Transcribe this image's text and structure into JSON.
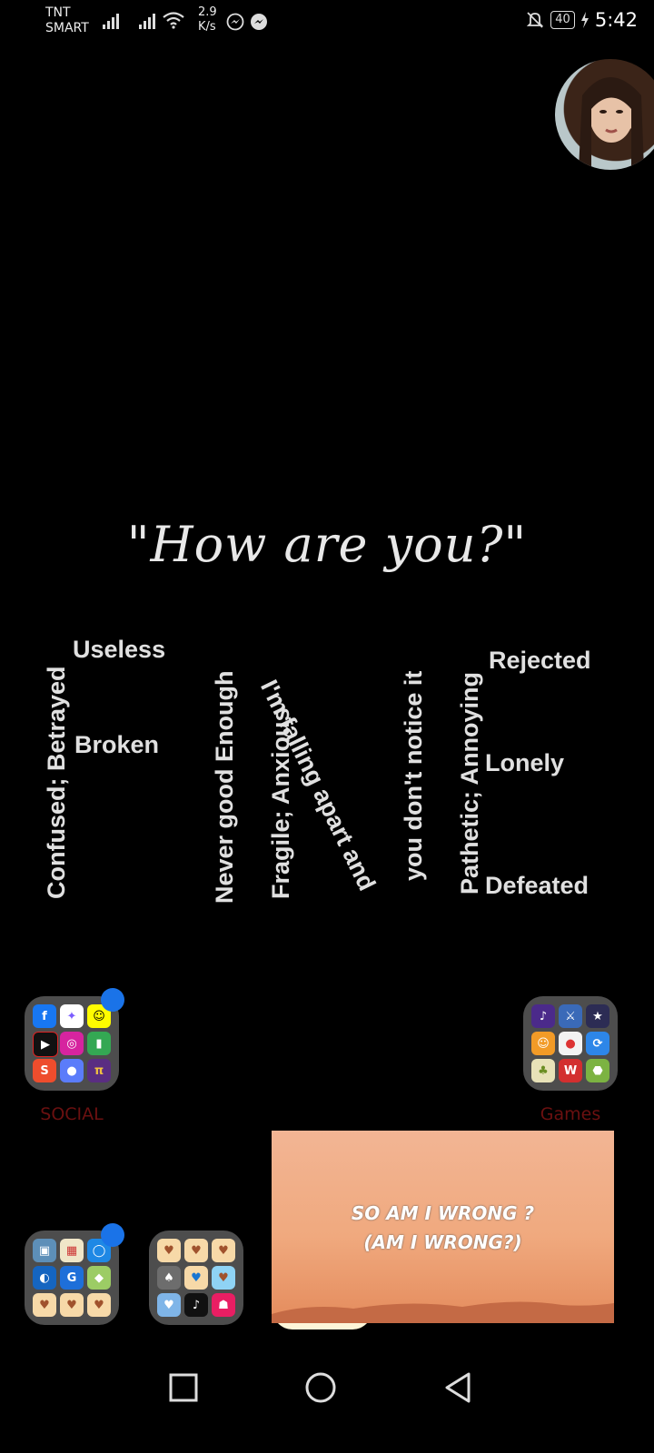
{
  "status_bar": {
    "carrier_line1": "TNT",
    "carrier_line2": "SMART",
    "speed_value": "2.9",
    "speed_unit": "K/s",
    "battery": "40",
    "time": "5:42",
    "icons": [
      "signal-icon",
      "signal-icon",
      "wifi-icon",
      "messenger-icon",
      "messenger-icon",
      "bell-off-icon",
      "charging-icon"
    ]
  },
  "wallpaper": {
    "quote": "\"How are you?\"",
    "words": {
      "useless": "Useless",
      "broken": "Broken",
      "confused": "Confused; Betrayed",
      "never_good": "Never good Enough",
      "fragile": "Fragile; Anxious",
      "falling": "I'm falling apart and",
      "notice": "you don't notice it",
      "pathetic": "Pathetic; Annoying",
      "rejected": "Rejected",
      "lonely": "Lonely",
      "defeated": "Defeated"
    }
  },
  "folders": {
    "social": {
      "label": "SOCIAL"
    },
    "games": {
      "label": "Games"
    }
  },
  "video": {
    "lyric_line1": "SO AM I WRONG ?",
    "lyric_line2": "(AM I WRONG?)"
  },
  "colors": {
    "accent_dot": "#1a73e8",
    "folder_label": "#6b1010"
  }
}
